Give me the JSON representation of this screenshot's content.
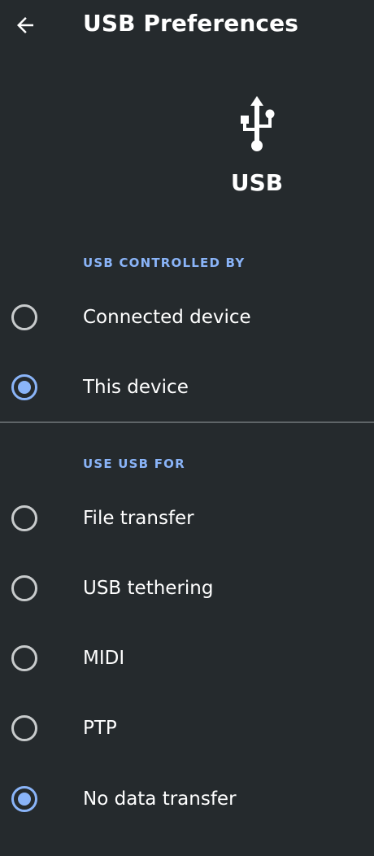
{
  "header": {
    "title": "USB Preferences"
  },
  "hero": {
    "icon": "usb-icon",
    "label": "USB"
  },
  "controlled_by": {
    "header": "USB CONTROLLED BY",
    "options": [
      {
        "label": "Connected device",
        "selected": false
      },
      {
        "label": "This device",
        "selected": true
      }
    ]
  },
  "use_for": {
    "header": "USE USB FOR",
    "options": [
      {
        "label": "File transfer",
        "selected": false
      },
      {
        "label": "USB tethering",
        "selected": false
      },
      {
        "label": "MIDI",
        "selected": false
      },
      {
        "label": "PTP",
        "selected": false
      },
      {
        "label": "No data transfer",
        "selected": true
      }
    ]
  },
  "colors": {
    "background": "#252a2d",
    "accent": "#8ab4f8",
    "radio_unchecked": "#c8cbcc",
    "divider": "#5f6568"
  }
}
